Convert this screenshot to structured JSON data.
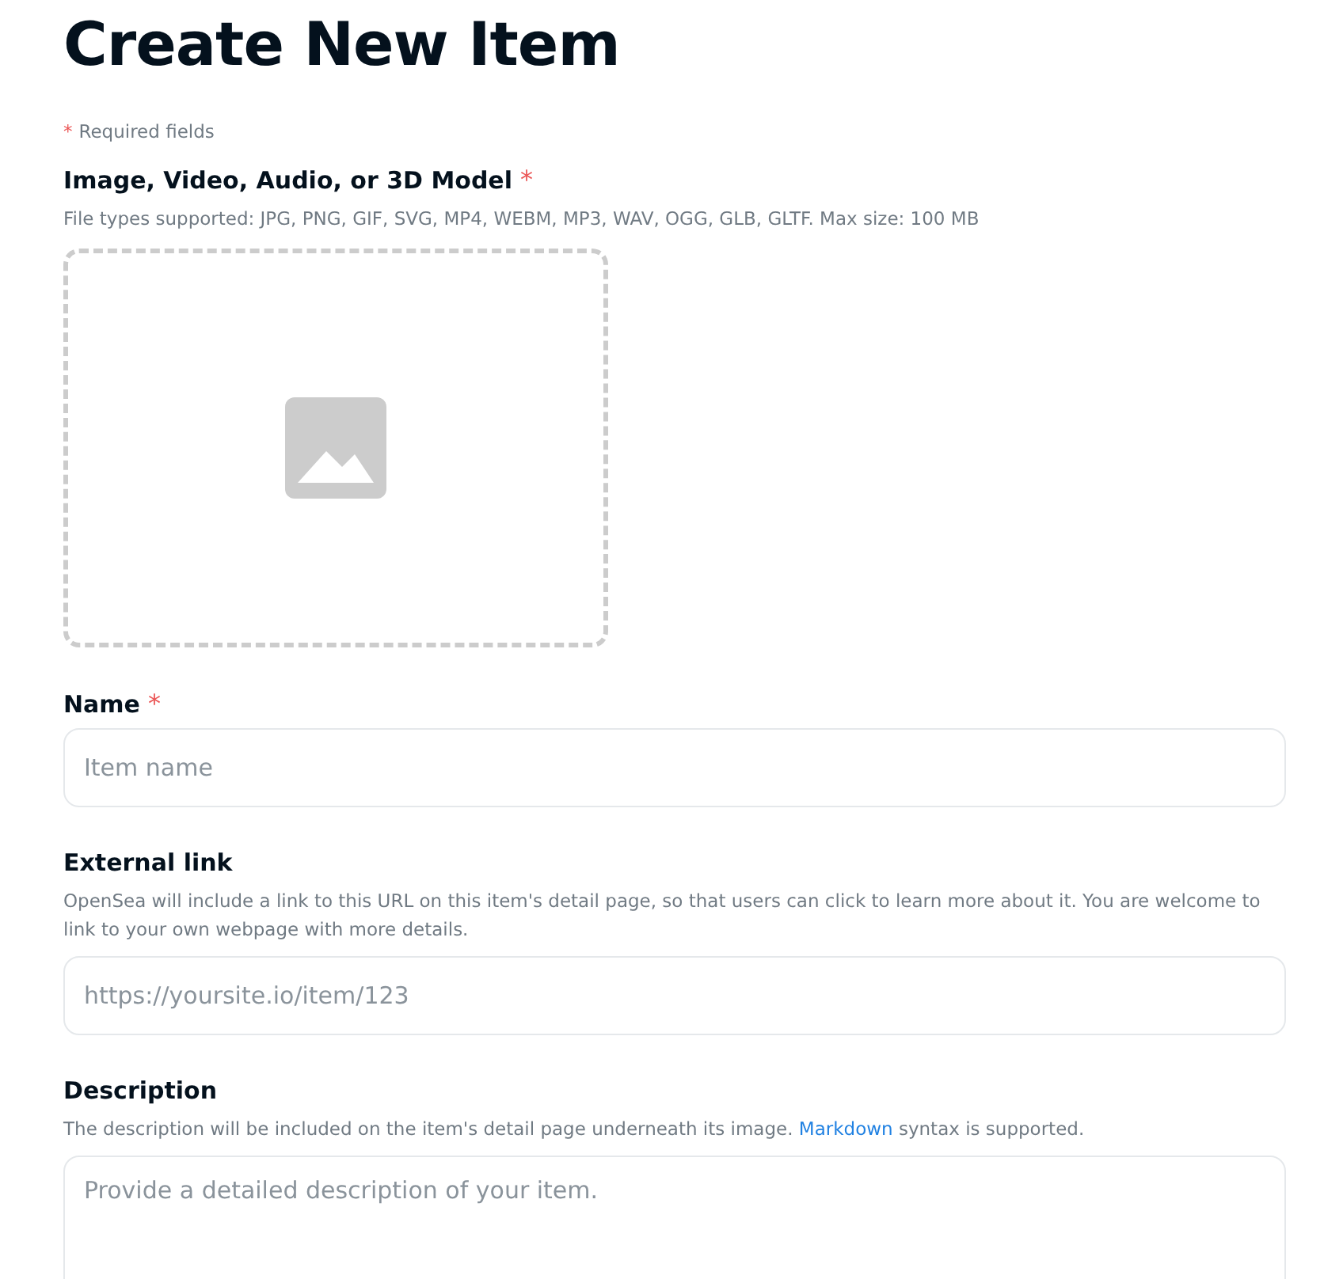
{
  "title": "Create New Item",
  "required_note": {
    "mark": "*",
    "text": "Required fields"
  },
  "fields": [
    {
      "kind": "upload",
      "label": "Image, Video, Audio, or 3D Model",
      "required_mark": "*",
      "help": "File types supported: JPG, PNG, GIF, SVG, MP4, WEBM, MP3, WAV, OGG, GLB, GLTF. Max size: 100 MB"
    },
    {
      "kind": "input",
      "label": "Name",
      "required_mark": "*",
      "placeholder": "Item name"
    },
    {
      "kind": "input",
      "label": "External link",
      "help": "OpenSea will include a link to this URL on this item's detail page, so that users can click to learn more about it. You are welcome to link to your own webpage with more details.",
      "placeholder": "https://yoursite.io/item/123"
    },
    {
      "kind": "textarea",
      "label": "Description",
      "help": "The description will be included on the item's detail page underneath its image.",
      "help_link": "Markdown",
      "help_after": "syntax is supported.",
      "placeholder": "Provide a detailed description of your item."
    }
  ]
}
